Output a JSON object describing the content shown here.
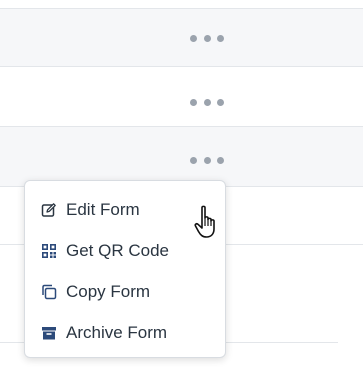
{
  "rows": [
    {
      "more_icon": "ellipsis-icon"
    },
    {
      "more_icon": "ellipsis-icon"
    },
    {
      "more_icon": "ellipsis-icon"
    }
  ],
  "menu": {
    "items": [
      {
        "label": "Edit Form",
        "icon": "edit-icon"
      },
      {
        "label": "Get QR Code",
        "icon": "qr-code-icon"
      },
      {
        "label": "Copy Form",
        "icon": "copy-icon"
      },
      {
        "label": "Archive Form",
        "icon": "archive-icon"
      }
    ]
  },
  "colors": {
    "icon_accent": "#2c4a7a",
    "menu_text": "#2a3541",
    "ellipsis": "#9ba3ad",
    "row_shade": "#f6f7f9",
    "divider": "#e3e6ea"
  }
}
